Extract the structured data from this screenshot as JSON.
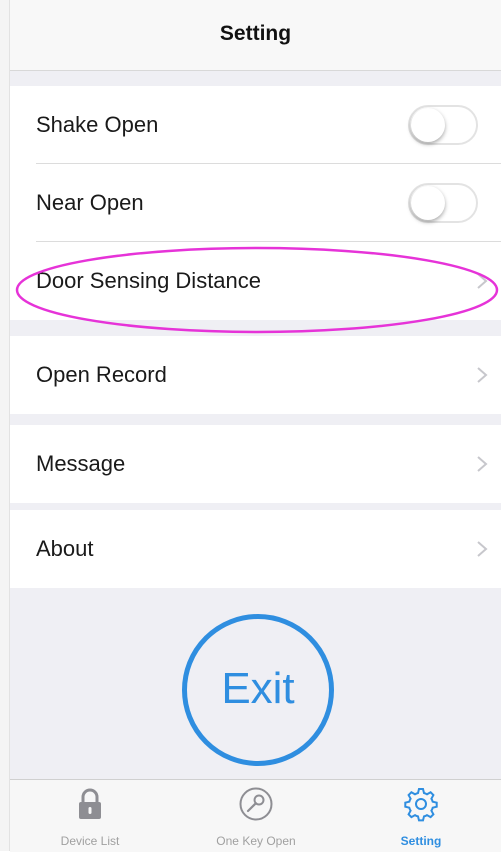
{
  "header": {
    "title": "Setting"
  },
  "settings": {
    "shake_open": {
      "label": "Shake Open",
      "enabled": false
    },
    "near_open": {
      "label": "Near Open",
      "enabled": false
    },
    "door_sensing_distance": {
      "label": "Door Sensing Distance"
    },
    "open_record": {
      "label": "Open Record"
    },
    "message": {
      "label": "Message"
    },
    "about": {
      "label": "About"
    }
  },
  "exit_label": "Exit",
  "tabs": [
    {
      "label": "Device List",
      "icon": "lock-icon",
      "active": false
    },
    {
      "label": "One Key Open",
      "icon": "key-icon",
      "active": false
    },
    {
      "label": "Setting",
      "icon": "gear-icon",
      "active": true
    }
  ],
  "colors": {
    "accent": "#2f8ee0",
    "highlight": "#e633d8",
    "group_background": "#efeff4"
  }
}
